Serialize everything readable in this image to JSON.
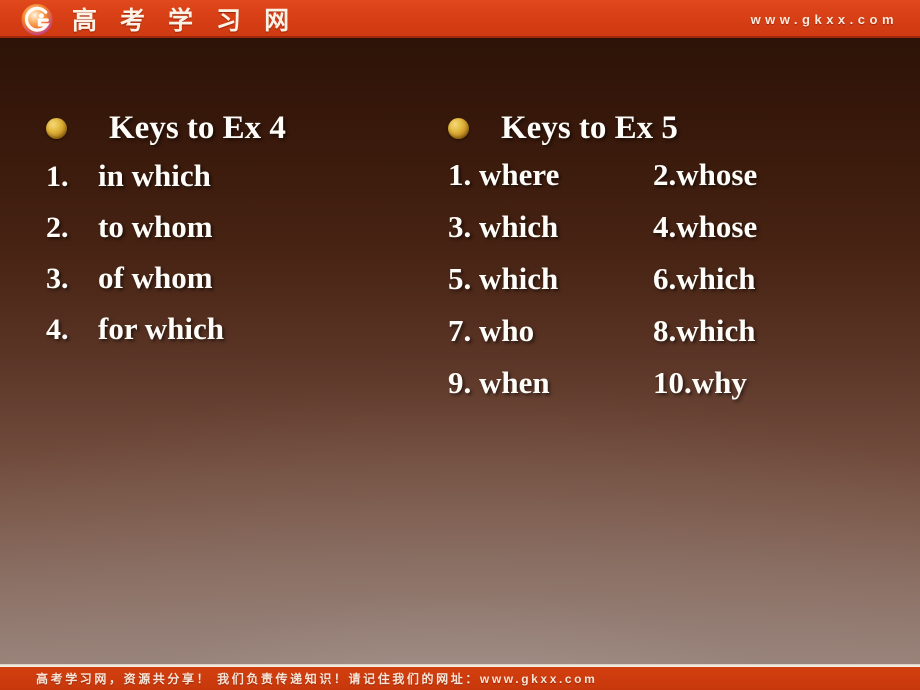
{
  "header": {
    "logo_icon": "gkxx-circle-g-logo-icon",
    "brand_chars": [
      "高",
      "考",
      "学",
      "习",
      "网"
    ],
    "brand_title": "高考学习网",
    "url": "www.gkxx.com"
  },
  "slide": {
    "background_top_color": "#2a1107",
    "background_bottom_color": "#9a8379",
    "accent_color": "#d53d14",
    "text_color": "#fffdf9",
    "bullet_color": "#e3b93f"
  },
  "left_column": {
    "bullet_icon": "gold-sphere-bullet-icon",
    "heading": "Keys to Ex 4",
    "items": [
      {
        "num": "1.",
        "answer": "in which"
      },
      {
        "num": "2.",
        "answer": "to whom"
      },
      {
        "num": "3.",
        "answer": "of whom"
      },
      {
        "num": "4.",
        "answer": "for which"
      }
    ]
  },
  "right_column": {
    "bullet_icon": "gold-sphere-bullet-icon",
    "heading": "Keys to Ex 5",
    "rows": [
      {
        "left": "1. where",
        "right": "2.whose"
      },
      {
        "left": "3. which",
        "right": "4.whose"
      },
      {
        "left": "5. which",
        "right": "6.which"
      },
      {
        "left": "7.  who",
        "right": "8.which"
      },
      {
        "left": "9.  when",
        "right": "10.why"
      }
    ]
  },
  "footer": {
    "text": "高考学习网，资源共分享！ 我们负责传递知识！请记住我们的网址：www.gkxx.com"
  }
}
